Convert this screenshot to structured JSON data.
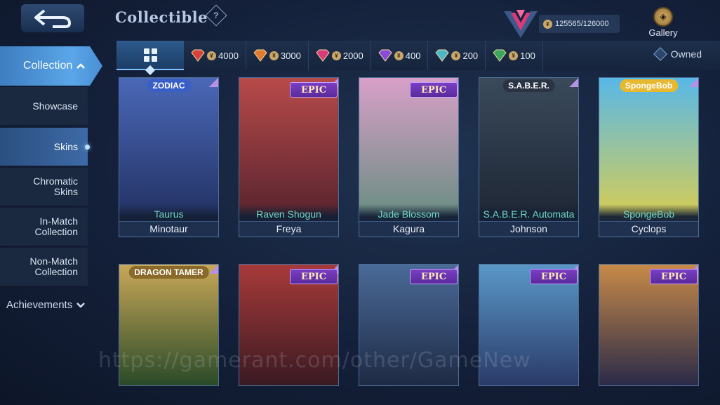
{
  "header": {
    "title": "Collectible",
    "points": "125565/126000",
    "gallery_label": "Gallery",
    "coin_symbol": "¥"
  },
  "sidebar": {
    "collection_label": "Collection",
    "items": [
      {
        "label": "Showcase",
        "active": false
      },
      {
        "label": "Skins",
        "active": true
      },
      {
        "label": "Chromatic Skins",
        "active": false
      },
      {
        "label": "In-Match Collection",
        "active": false
      },
      {
        "label": "Non-Match Collection",
        "active": false
      }
    ],
    "achievements_label": "Achievements"
  },
  "tabs": {
    "tiers": [
      {
        "value": "4000",
        "color": "#d8423a"
      },
      {
        "value": "3000",
        "color": "#e07a2e"
      },
      {
        "value": "2000",
        "color": "#d83a7a"
      },
      {
        "value": "400",
        "color": "#8a4ad8"
      },
      {
        "value": "200",
        "color": "#4ab8c8"
      },
      {
        "value": "100",
        "color": "#3aa85a"
      }
    ],
    "owned_label": "Owned"
  },
  "cards": [
    {
      "skin": "Taurus",
      "hero": "Minotaur",
      "badge": "ZODIAC",
      "badge_color": "#3a5ec8",
      "art_top": "#4a68b8",
      "art_bottom": "#1e2a58"
    },
    {
      "skin": "Raven Shogun",
      "hero": "Freya",
      "badge": "EPIC",
      "art_top": "#b84a4a",
      "art_bottom": "#4a1e2a"
    },
    {
      "skin": "Jade Blossom",
      "hero": "Kagura",
      "badge": "EPIC",
      "art_top": "#d8a0c8",
      "art_bottom": "#5a8a78"
    },
    {
      "skin": "S.A.B.E.R. Automata",
      "hero": "Johnson",
      "badge": "S.A.B.E.R.",
      "badge_color": "#2a3444",
      "art_top": "#3a4a5a",
      "art_bottom": "#1a2230"
    },
    {
      "skin": "SpongeBob",
      "hero": "Cyclops",
      "badge": "SpongeBob",
      "badge_color": "#e8b830",
      "art_top": "#58b8e8",
      "art_bottom": "#e8d040"
    },
    {
      "badge": "DRAGON TAMER",
      "badge_color": "#8a6a2a",
      "art_top": "#c8a858",
      "art_bottom": "#2a4a28"
    },
    {
      "badge": "EPIC",
      "art_top": "#a83a3a",
      "art_bottom": "#3a1a22"
    },
    {
      "badge": "EPIC",
      "art_top": "#4a6a98",
      "art_bottom": "#1e2a44"
    },
    {
      "badge": "EPIC",
      "art_top": "#5a98c8",
      "art_bottom": "#2a3a68"
    },
    {
      "badge": "EPIC",
      "art_top": "#c88a48",
      "art_bottom": "#2a2a48"
    }
  ],
  "watermark": "https://gamerant.com/other/GameNew"
}
